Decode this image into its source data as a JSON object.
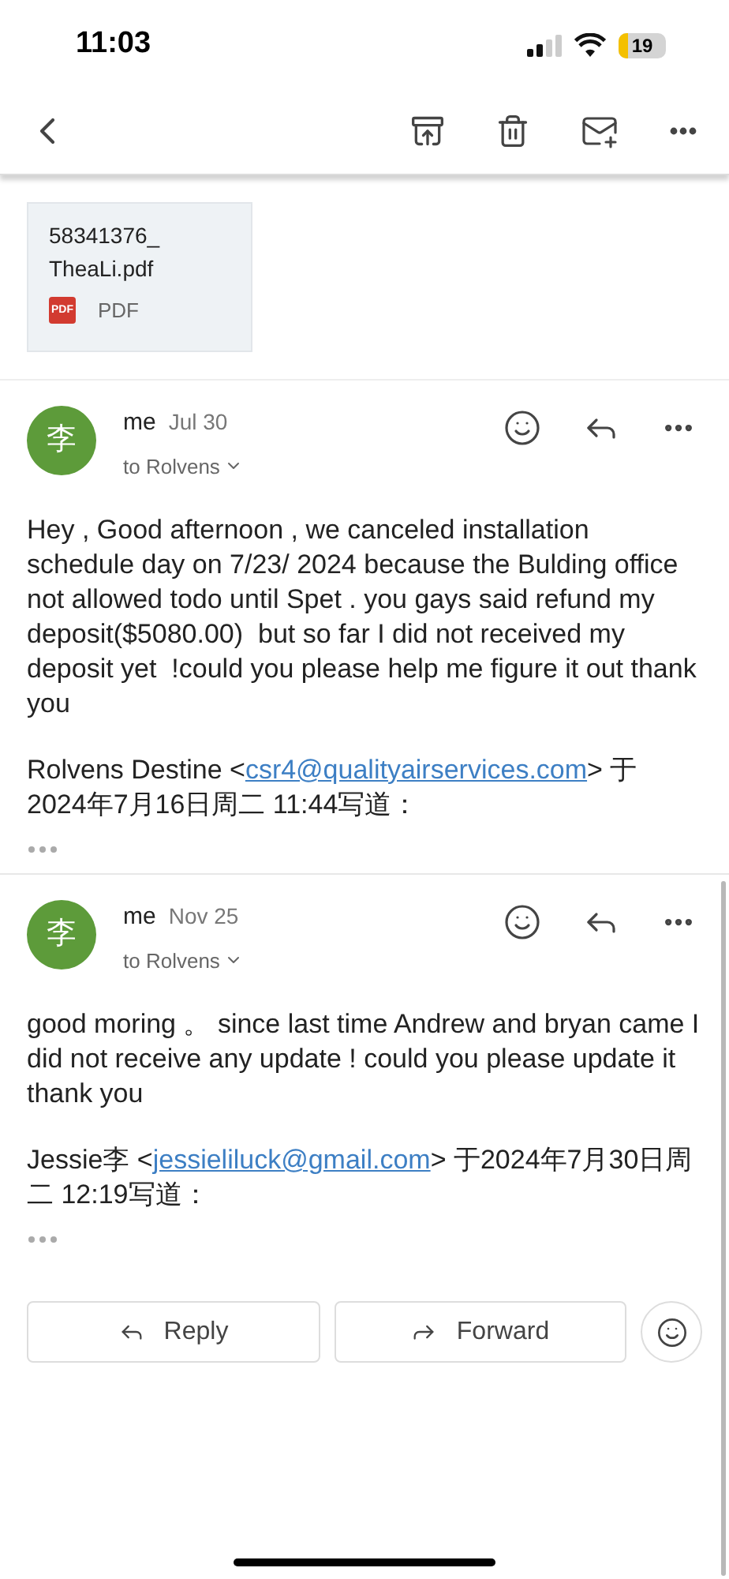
{
  "status_bar": {
    "time": "11:03",
    "battery": "19"
  },
  "attachment": {
    "filename": "58341376_\nTheaLi.pdf",
    "type_badge": "PDF",
    "type_label": "PDF"
  },
  "messages": [
    {
      "avatar": "李",
      "sender": "me",
      "date": "Jul 30",
      "recipients": "to Rolvens",
      "body": "Hey , Good afternoon , we canceled installation schedule day on 7/23/ 2024 because the Bulding office not allowed todo until Spet . you gays said refund my deposit($5080.00)  but so far I did not received my deposit yet  !could you please help me figure it out thank you",
      "quote": {
        "before": "Rolvens Destine <",
        "link": "csr4@qualityairservices.com",
        "after": "> 于 2024年7月16日周二 11:44写道："
      }
    },
    {
      "avatar": "李",
      "sender": "me",
      "date": "Nov 25",
      "recipients": "to Rolvens",
      "body": "good moring 。 since last time Andrew and bryan came I did not receive any update ! could you please update it thank you",
      "quote": {
        "before": "Jessie李 <",
        "link": "jessieliluck@gmail.com",
        "after": "> 于2024年7月30日周二 12:19写道："
      }
    }
  ],
  "actions": {
    "reply": "Reply",
    "forward": "Forward"
  }
}
